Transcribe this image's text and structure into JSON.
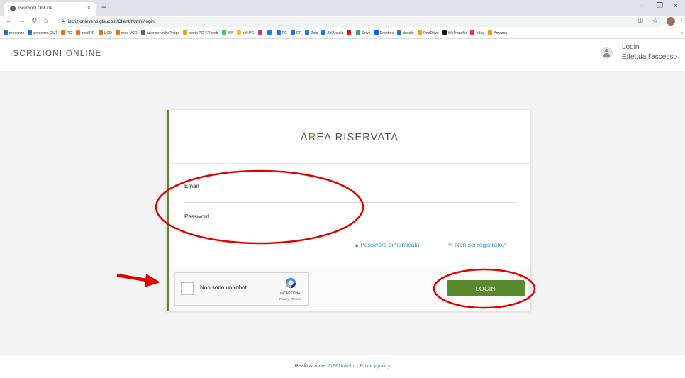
{
  "browser": {
    "tab_title": "Iscrizioni OnLine",
    "tab_close": "×",
    "new_tab": "+",
    "url": "iscrizionieventi.glauco.it/Client/html/#/login",
    "window_controls": [
      "–",
      "❐",
      "×"
    ],
    "bookmarks": [
      {
        "label": "presenze",
        "color": "#2b6cc4"
      },
      {
        "label": "presenze OUT",
        "color": "#2b6cc4"
      },
      {
        "label": "PG",
        "color": "#e8711a"
      },
      {
        "label": "mod PG",
        "color": "#e8711a"
      },
      {
        "label": "UCD",
        "color": "#e8711a"
      },
      {
        "label": "mod UCD",
        "color": "#e8711a"
      },
      {
        "label": "aziende.unibo?https",
        "color": "#5f6368"
      },
      {
        "label": "posta PG-ER web",
        "color": "#f0a30a"
      },
      {
        "label": "WA",
        "color": "#25d366"
      },
      {
        "label": "cell PG",
        "color": "#f5c518"
      },
      {
        "label": "",
        "color": "#c13584"
      },
      {
        "label": "",
        "color": "#1877f2"
      },
      {
        "label": "PG",
        "color": "#1877f2"
      },
      {
        "label": "ER",
        "color": "#1877f2"
      },
      {
        "label": "Zola",
        "color": "#1877f2"
      },
      {
        "label": "ZolAnzola",
        "color": "#1877f2"
      },
      {
        "label": "",
        "color": "#ff0000"
      },
      {
        "label": "Drive",
        "color": "#34a853"
      },
      {
        "label": "Dropbox",
        "color": "#0061ff"
      },
      {
        "label": "doodle",
        "color": "#1a73e8"
      },
      {
        "label": "OneDrive",
        "color": "#f0a30a"
      },
      {
        "label": "WeTransfer",
        "color": "#111111"
      },
      {
        "label": "eBay",
        "color": "#e53238"
      },
      {
        "label": "Amazon",
        "color": "#ff9900"
      }
    ],
    "more_bookmarks": "»"
  },
  "header": {
    "brand_first": "I",
    "brand_mid1": "SCRIZIONI ",
    "brand_accent": "O",
    "brand_mid2": "NLINE",
    "login_title": "Login",
    "login_subtitle": "Effettua l'accesso"
  },
  "card": {
    "title_first": "A",
    "title_accent": "R",
    "title_rest": "EA RISERVATA",
    "email_label": "Email",
    "password_label": "Password",
    "forgot_password": "Password dimenticata",
    "not_registered": "Non sei registrato?",
    "login_button": "LOGIN"
  },
  "recaptcha": {
    "label": "Non sono un robot",
    "brand": "reCAPTCHA",
    "terms": "Privacy - Termini"
  },
  "footer": {
    "prefix": "Realizzazione",
    "company_link": "IDS&Unitelm",
    "separator": "-",
    "privacy_link": "Privacy policy"
  },
  "colors": {
    "accent_green": "#5a8a2e",
    "link_blue": "#4a90d4",
    "annotation_red": "#e00000"
  }
}
